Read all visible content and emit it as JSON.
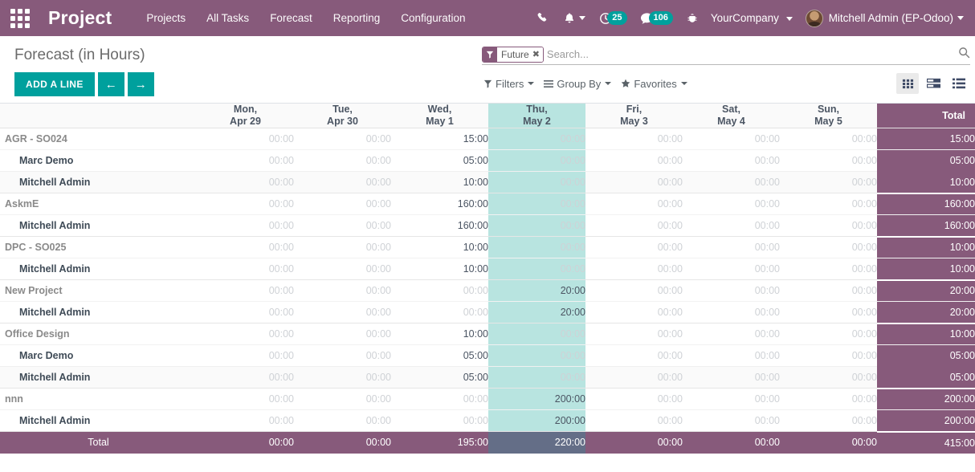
{
  "navbar": {
    "apps_icon": "apps-grid-icon",
    "brand": "Project",
    "menu": [
      {
        "label": "Projects"
      },
      {
        "label": "All Tasks"
      },
      {
        "label": "Forecast"
      },
      {
        "label": "Reporting"
      },
      {
        "label": "Configuration"
      }
    ],
    "phone_icon": "phone-icon",
    "bell_icon": "bell-icon",
    "activity_icon": "clock-icon",
    "activity_count": "25",
    "messages_icon": "chat-icon",
    "messages_count": "106",
    "debug_icon": "bug-icon",
    "company": "YourCompany",
    "user": "Mitchell Admin (EP-Odoo)",
    "accent_purple": "#875a7b",
    "accent_teal": "#00a09d"
  },
  "control_panel": {
    "title": "Forecast (in Hours)",
    "add_line_label": "ADD A LINE",
    "prev_label": "←",
    "next_label": "→",
    "search": {
      "facet_label": "Future",
      "facet_remove": "✖",
      "placeholder": "Search..."
    },
    "filters_label": "Filters",
    "groupby_label": "Group By",
    "favorites_label": "Favorites",
    "views": [
      {
        "name": "grid-view",
        "active": true
      },
      {
        "name": "kanban-view",
        "active": false
      },
      {
        "name": "list-view",
        "active": false
      }
    ]
  },
  "grid": {
    "label_header": "",
    "columns": [
      {
        "day": "Mon,",
        "date": "Apr 29",
        "today": false
      },
      {
        "day": "Tue,",
        "date": "Apr 30",
        "today": false
      },
      {
        "day": "Wed,",
        "date": "May 1",
        "today": false
      },
      {
        "day": "Thu,",
        "date": "May 2",
        "today": true
      },
      {
        "day": "Fri,",
        "date": "May 3",
        "today": false
      },
      {
        "day": "Sat,",
        "date": "May 4",
        "today": false
      },
      {
        "day": "Sun,",
        "date": "May 5",
        "today": false
      }
    ],
    "total_header": "Total",
    "groups": [
      {
        "label": "AGR - SO024",
        "values": [
          "00:00",
          "00:00",
          "15:00",
          "00:00",
          "00:00",
          "00:00",
          "00:00"
        ],
        "total": "15:00",
        "children": [
          {
            "label": "Marc Demo",
            "values": [
              "00:00",
              "00:00",
              "05:00",
              "00:00",
              "00:00",
              "00:00",
              "00:00"
            ],
            "total": "05:00"
          },
          {
            "label": "Mitchell Admin",
            "values": [
              "00:00",
              "00:00",
              "10:00",
              "00:00",
              "00:00",
              "00:00",
              "00:00"
            ],
            "total": "10:00"
          }
        ]
      },
      {
        "label": "AskmE",
        "values": [
          "00:00",
          "00:00",
          "160:00",
          "00:00",
          "00:00",
          "00:00",
          "00:00"
        ],
        "total": "160:00",
        "children": [
          {
            "label": "Mitchell Admin",
            "values": [
              "00:00",
              "00:00",
              "160:00",
              "00:00",
              "00:00",
              "00:00",
              "00:00"
            ],
            "total": "160:00"
          }
        ]
      },
      {
        "label": "DPC - SO025",
        "values": [
          "00:00",
          "00:00",
          "10:00",
          "00:00",
          "00:00",
          "00:00",
          "00:00"
        ],
        "total": "10:00",
        "children": [
          {
            "label": "Mitchell Admin",
            "values": [
              "00:00",
              "00:00",
              "10:00",
              "00:00",
              "00:00",
              "00:00",
              "00:00"
            ],
            "total": "10:00"
          }
        ]
      },
      {
        "label": "New Project",
        "values": [
          "00:00",
          "00:00",
          "00:00",
          "20:00",
          "00:00",
          "00:00",
          "00:00"
        ],
        "total": "20:00",
        "children": [
          {
            "label": "Mitchell Admin",
            "values": [
              "00:00",
              "00:00",
              "00:00",
              "20:00",
              "00:00",
              "00:00",
              "00:00"
            ],
            "total": "20:00"
          }
        ]
      },
      {
        "label": "Office Design",
        "values": [
          "00:00",
          "00:00",
          "10:00",
          "00:00",
          "00:00",
          "00:00",
          "00:00"
        ],
        "total": "10:00",
        "children": [
          {
            "label": "Marc Demo",
            "values": [
              "00:00",
              "00:00",
              "05:00",
              "00:00",
              "00:00",
              "00:00",
              "00:00"
            ],
            "total": "05:00"
          },
          {
            "label": "Mitchell Admin",
            "values": [
              "00:00",
              "00:00",
              "05:00",
              "00:00",
              "00:00",
              "00:00",
              "00:00"
            ],
            "total": "05:00"
          }
        ]
      },
      {
        "label": "nnn",
        "values": [
          "00:00",
          "00:00",
          "00:00",
          "200:00",
          "00:00",
          "00:00",
          "00:00"
        ],
        "total": "200:00",
        "children": [
          {
            "label": "Mitchell Admin",
            "values": [
              "00:00",
              "00:00",
              "00:00",
              "200:00",
              "00:00",
              "00:00",
              "00:00"
            ],
            "total": "200:00"
          }
        ]
      }
    ],
    "footer": {
      "label": "Total",
      "values": [
        "00:00",
        "00:00",
        "195:00",
        "220:00",
        "00:00",
        "00:00",
        "00:00"
      ],
      "total": "415:00"
    }
  }
}
